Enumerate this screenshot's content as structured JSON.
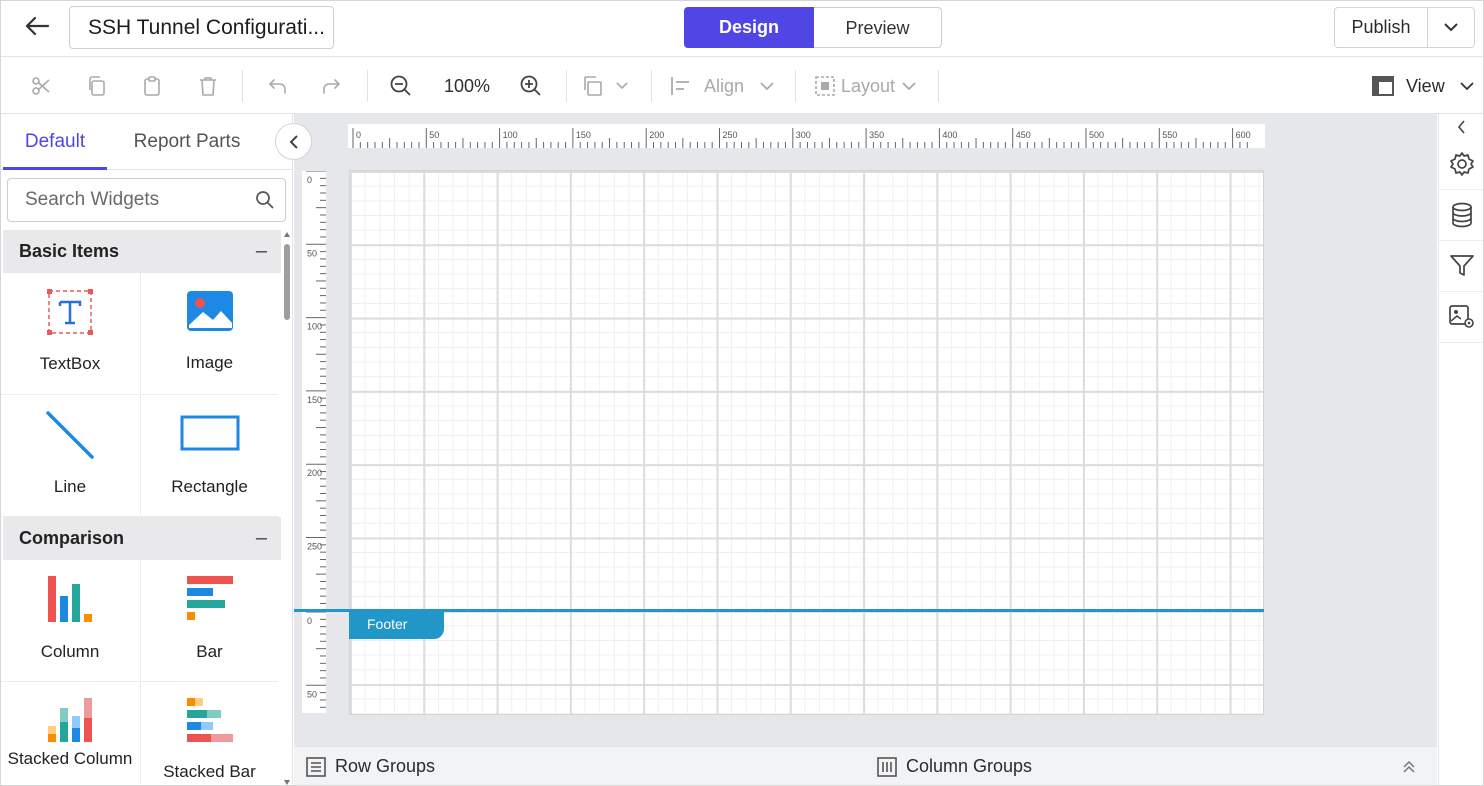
{
  "header": {
    "title": "SSH Tunnel Configurati...",
    "mode_tabs": [
      "Design",
      "Preview"
    ],
    "publish_label": "Publish"
  },
  "toolbar": {
    "zoom": "100%",
    "align_label": "Align",
    "layout_label": "Layout",
    "view_label": "View"
  },
  "left_panel": {
    "tabs": [
      "Default",
      "Report Parts"
    ],
    "search_placeholder": "Search Widgets",
    "groups": [
      {
        "name": "Basic Items",
        "items": [
          "TextBox",
          "Image",
          "Line",
          "Rectangle"
        ]
      },
      {
        "name": "Comparison",
        "items": [
          "Column",
          "Bar",
          "Stacked Column",
          "Stacked Bar"
        ]
      }
    ]
  },
  "rulers": {
    "horizontal": [
      "0",
      "50",
      "100",
      "150",
      "200",
      "250",
      "300",
      "350",
      "400",
      "450",
      "500",
      "550",
      "600"
    ],
    "vertical_body": [
      "0",
      "50",
      "100",
      "150",
      "200",
      "250"
    ],
    "vertical_footer": [
      "0",
      "50"
    ]
  },
  "canvas": {
    "footer_label": "Footer"
  },
  "bottom_bar": {
    "row_groups": "Row Groups",
    "column_groups": "Column Groups"
  },
  "colors": {
    "accent": "#4f46e5",
    "footer": "#2196c9",
    "panel_bg": "#e6e7ea"
  },
  "icons": {
    "toolbar": [
      "cut-icon",
      "copy-icon",
      "paste-icon",
      "delete-icon",
      "undo-icon",
      "redo-icon",
      "zoom-out-icon",
      "zoom-in-icon",
      "arrange-icon",
      "align-icon",
      "layout-icon",
      "view-icon"
    ],
    "right_bar": [
      "chevron-left-icon",
      "settings-icon",
      "database-icon",
      "filter-icon",
      "image-settings-icon"
    ]
  }
}
